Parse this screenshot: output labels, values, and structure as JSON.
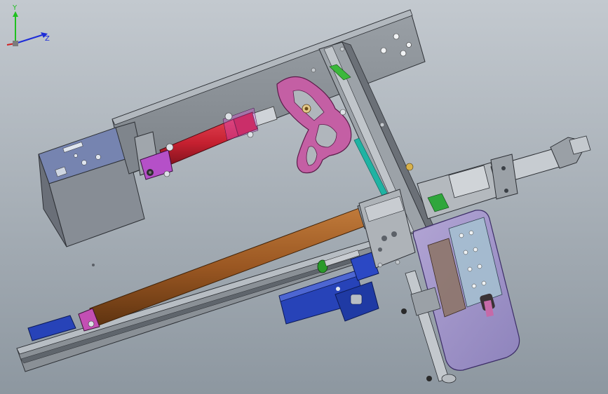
{
  "viewport": {
    "background_top": "#bfc5cb",
    "background_bottom": "#8f99a2"
  },
  "colors": {
    "frame_gray": "#8a9096",
    "frame_edge": "#2d3035",
    "rod_red": "#c82436",
    "rod_orange": "#9c5a24",
    "cam_magenta": "#c45fa4",
    "bracket_blue": "#1f3fb6",
    "housing_purple": "#a593c9",
    "box_blue": "#6675a3",
    "axis_y": "#20c020",
    "axis_z": "#1d2cd8",
    "axis_x": "#d02020"
  },
  "triad": {
    "y_label": "Y",
    "z_label": "Z"
  }
}
